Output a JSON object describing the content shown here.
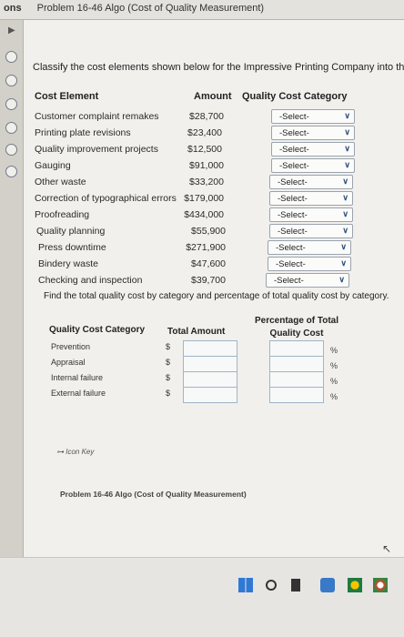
{
  "tab": {
    "prefix": "ons",
    "title": "Problem 16-46 Algo (Cost of Quality Measurement)"
  },
  "instructions": "Classify the cost elements shown below for the Impressive Printing Company into th",
  "table1": {
    "headers": {
      "element": "Cost Element",
      "amount": "Amount",
      "category": "Quality Cost Category"
    },
    "rows": [
      {
        "name": "Customer complaint remakes",
        "amount": "$28,700",
        "select": "-Select-"
      },
      {
        "name": "Printing plate revisions",
        "amount": "$23,400",
        "select": "-Select-"
      },
      {
        "name": "Quality improvement projects",
        "amount": "$12,500",
        "select": "-Select-"
      },
      {
        "name": "Gauging",
        "amount": "$91,000",
        "select": "-Select-"
      },
      {
        "name": "Other waste",
        "amount": "$33,200",
        "select": "-Select-"
      },
      {
        "name": "Correction of typographical errors",
        "amount": "$179,000",
        "select": "-Select-"
      },
      {
        "name": "Proofreading",
        "amount": "$434,000",
        "select": "-Select-"
      },
      {
        "name": "Quality planning",
        "amount": "$55,900",
        "select": "-Select-"
      },
      {
        "name": "Press downtime",
        "amount": "$271,900",
        "select": "-Select-"
      },
      {
        "name": "Bindery waste",
        "amount": "$47,600",
        "select": "-Select-"
      },
      {
        "name": "Checking and inspection",
        "amount": "$39,700",
        "select": "-Select-"
      }
    ]
  },
  "find_text": "Find the total quality cost by category and percentage of total quality cost by category.",
  "table2": {
    "headers": {
      "category": "Quality Cost Category",
      "total": "Total Amount",
      "pct_line1": "Percentage of Total",
      "pct_line2": "Quality Cost"
    },
    "rows": [
      {
        "category": "Prevention",
        "currency": "$",
        "pct_sign": "%"
      },
      {
        "category": "Appraisal",
        "currency": "$",
        "pct_sign": "%"
      },
      {
        "category": "Internal failure",
        "currency": "$",
        "pct_sign": "%"
      },
      {
        "category": "External failure",
        "currency": "$",
        "pct_sign": "%"
      }
    ]
  },
  "icon_key": "Icon Key",
  "footer_problem": "Problem 16-46 Algo (Cost of Quality Measurement)",
  "colors": {
    "select_chevron": "#2b4d7a",
    "radio_border": "#6f7a86",
    "input_border": "#9fb6c8"
  }
}
